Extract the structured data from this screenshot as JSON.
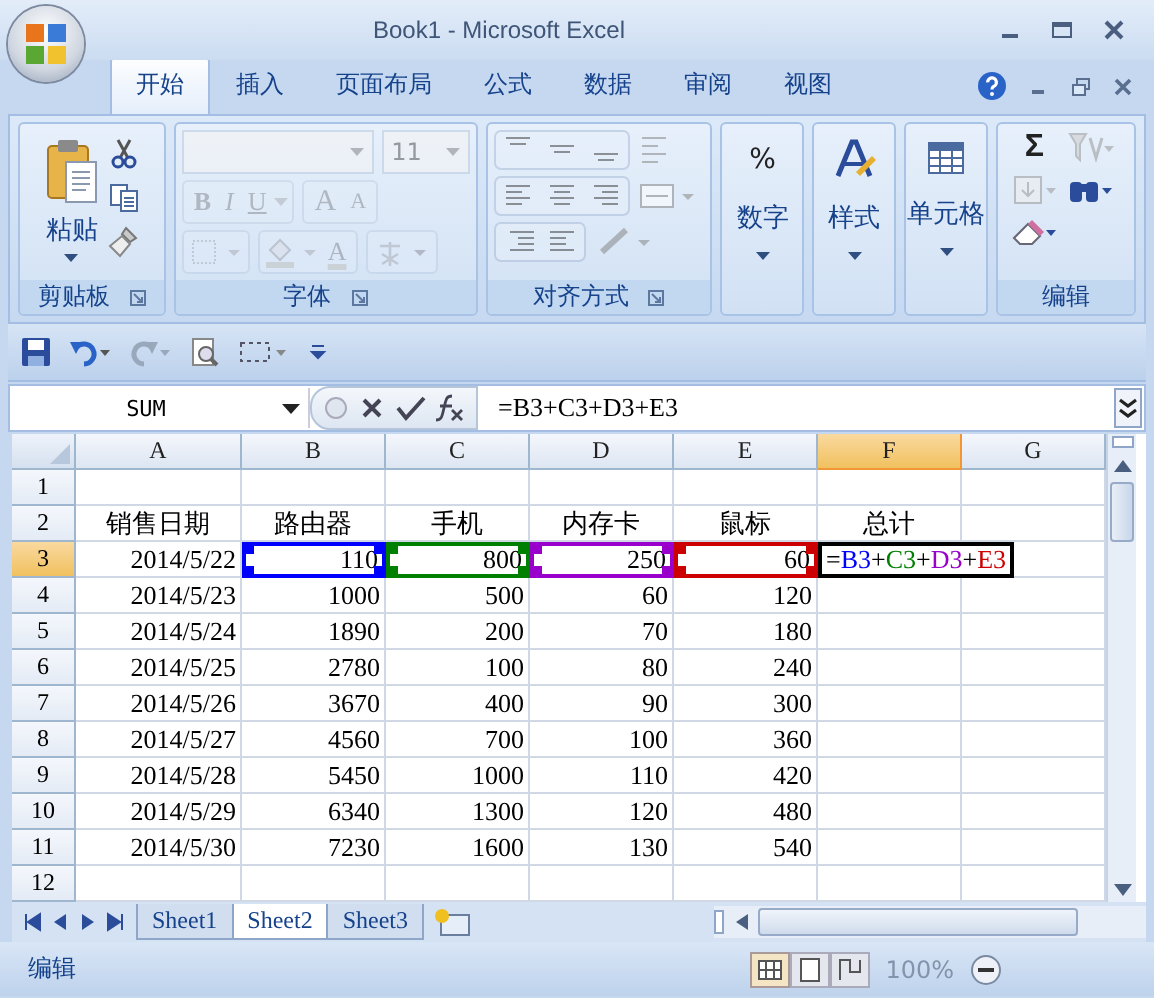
{
  "window": {
    "title": "Book1 - Microsoft Excel"
  },
  "tabs": [
    {
      "label": "开始",
      "selected": true
    },
    {
      "label": "插入",
      "selected": false
    },
    {
      "label": "页面布局",
      "selected": false
    },
    {
      "label": "公式",
      "selected": false
    },
    {
      "label": "数据",
      "selected": false
    },
    {
      "label": "审阅",
      "selected": false
    },
    {
      "label": "视图",
      "selected": false
    }
  ],
  "ribbon": {
    "clipboard": {
      "label": "剪贴板",
      "paste": "粘贴"
    },
    "font": {
      "label": "字体",
      "size": "11",
      "style_buttons": [
        "B",
        "I",
        "U"
      ],
      "size_buttons": [
        "A",
        "A"
      ],
      "color_button": "A",
      "disabled": true
    },
    "alignment": {
      "label": "对齐方式",
      "disabled": true
    },
    "number": {
      "label": "数字",
      "symbol": "%"
    },
    "styles": {
      "label": "样式"
    },
    "cells": {
      "label": "单元格"
    },
    "editing": {
      "label": "编辑",
      "sum_symbol": "Σ",
      "disabled": true
    }
  },
  "formula_bar": {
    "name_box": "SUM",
    "formula": "=B3+C3+D3+E3"
  },
  "columns": [
    {
      "label": "A",
      "selected": false
    },
    {
      "label": "B",
      "selected": false
    },
    {
      "label": "C",
      "selected": false
    },
    {
      "label": "D",
      "selected": false
    },
    {
      "label": "E",
      "selected": false
    },
    {
      "label": "F",
      "selected": true
    },
    {
      "label": "G",
      "selected": false
    }
  ],
  "rows": [
    {
      "num": "1",
      "selected": false,
      "cells": []
    },
    {
      "num": "2",
      "selected": false,
      "cells": [
        {
          "kind": "label",
          "text": "销售日期"
        },
        {
          "kind": "label",
          "text": "路由器"
        },
        {
          "kind": "label",
          "text": "手机"
        },
        {
          "kind": "label",
          "text": "内存卡"
        },
        {
          "kind": "label",
          "text": "鼠标"
        },
        {
          "kind": "label",
          "text": "总计"
        }
      ]
    },
    {
      "num": "3",
      "selected": true,
      "cells": [
        {
          "kind": "number",
          "text": "2014/5/22"
        },
        {
          "kind": "number",
          "text": "110",
          "color": "#0000ff"
        },
        {
          "kind": "number",
          "text": "800",
          "color": "#008000"
        },
        {
          "kind": "number",
          "text": "250",
          "color": "#9900cc"
        },
        {
          "kind": "number",
          "text": "60",
          "color": "#cc0000"
        },
        {
          "kind": "formula",
          "parts": [
            {
              "text": "=",
              "color": "#000000"
            },
            {
              "text": "B3",
              "color": "#0000ff"
            },
            {
              "text": "+",
              "color": "#000000"
            },
            {
              "text": "C3",
              "color": "#008000"
            },
            {
              "text": "+",
              "color": "#000000"
            },
            {
              "text": "D3",
              "color": "#9900cc"
            },
            {
              "text": "+",
              "color": "#000000"
            },
            {
              "text": "E3",
              "color": "#cc0000"
            }
          ]
        }
      ]
    },
    {
      "num": "4",
      "selected": false,
      "cells": [
        {
          "kind": "number",
          "text": "2014/5/23"
        },
        {
          "kind": "number",
          "text": "1000"
        },
        {
          "kind": "number",
          "text": "500"
        },
        {
          "kind": "number",
          "text": "60"
        },
        {
          "kind": "number",
          "text": "120"
        }
      ]
    },
    {
      "num": "5",
      "selected": false,
      "cells": [
        {
          "kind": "number",
          "text": "2014/5/24"
        },
        {
          "kind": "number",
          "text": "1890"
        },
        {
          "kind": "number",
          "text": "200"
        },
        {
          "kind": "number",
          "text": "70"
        },
        {
          "kind": "number",
          "text": "180"
        }
      ]
    },
    {
      "num": "6",
      "selected": false,
      "cells": [
        {
          "kind": "number",
          "text": "2014/5/25"
        },
        {
          "kind": "number",
          "text": "2780"
        },
        {
          "kind": "number",
          "text": "100"
        },
        {
          "kind": "number",
          "text": "80"
        },
        {
          "kind": "number",
          "text": "240"
        }
      ]
    },
    {
      "num": "7",
      "selected": false,
      "cells": [
        {
          "kind": "number",
          "text": "2014/5/26"
        },
        {
          "kind": "number",
          "text": "3670"
        },
        {
          "kind": "number",
          "text": "400"
        },
        {
          "kind": "number",
          "text": "90"
        },
        {
          "kind": "number",
          "text": "300"
        }
      ]
    },
    {
      "num": "8",
      "selected": false,
      "cells": [
        {
          "kind": "number",
          "text": "2014/5/27"
        },
        {
          "kind": "number",
          "text": "4560"
        },
        {
          "kind": "number",
          "text": "700"
        },
        {
          "kind": "number",
          "text": "100"
        },
        {
          "kind": "number",
          "text": "360"
        }
      ]
    },
    {
      "num": "9",
      "selected": false,
      "cells": [
        {
          "kind": "number",
          "text": "2014/5/28"
        },
        {
          "kind": "number",
          "text": "5450"
        },
        {
          "kind": "number",
          "text": "1000"
        },
        {
          "kind": "number",
          "text": "110"
        },
        {
          "kind": "number",
          "text": "420"
        }
      ]
    },
    {
      "num": "10",
      "selected": false,
      "cells": [
        {
          "kind": "number",
          "text": "2014/5/29"
        },
        {
          "kind": "number",
          "text": "6340"
        },
        {
          "kind": "number",
          "text": "1300"
        },
        {
          "kind": "number",
          "text": "120"
        },
        {
          "kind": "number",
          "text": "480"
        }
      ]
    },
    {
      "num": "11",
      "selected": false,
      "cells": [
        {
          "kind": "number",
          "text": "2014/5/30"
        },
        {
          "kind": "number",
          "text": "7230"
        },
        {
          "kind": "number",
          "text": "1600"
        },
        {
          "kind": "number",
          "text": "130"
        },
        {
          "kind": "number",
          "text": "540"
        }
      ]
    },
    {
      "num": "12",
      "selected": false,
      "cells": []
    }
  ],
  "sheet_tabs": [
    {
      "label": "Sheet1",
      "selected": false
    },
    {
      "label": "Sheet2",
      "selected": true
    },
    {
      "label": "Sheet3",
      "selected": false
    }
  ],
  "status_bar": {
    "mode": "编辑",
    "zoom": "100%"
  }
}
